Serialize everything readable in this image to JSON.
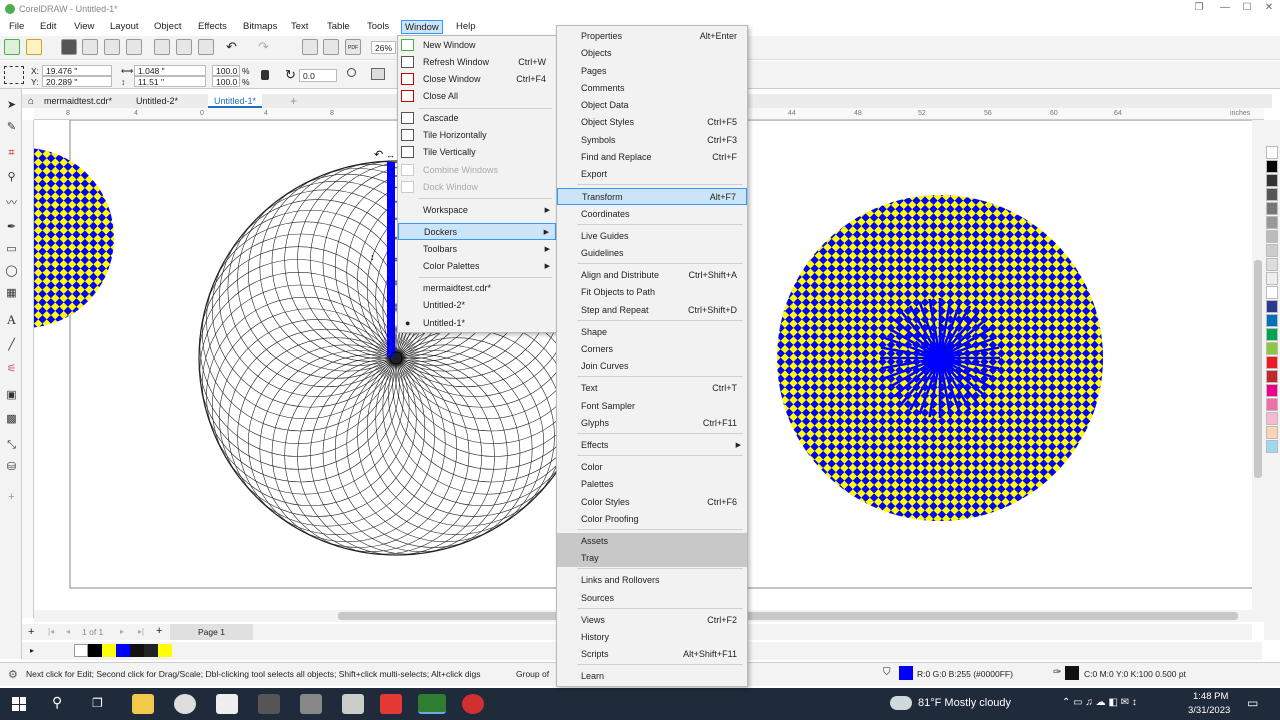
{
  "window": {
    "title": "CorelDRAW - Untitled-1*"
  },
  "menubar": [
    "File",
    "Edit",
    "View",
    "Layout",
    "Object",
    "Effects",
    "Bitmaps",
    "Text",
    "Table",
    "Tools",
    "Window",
    "Help"
  ],
  "toolbar": {
    "zoom": "26%"
  },
  "props": {
    "x": "19.476 \"",
    "y": "20.289 \"",
    "w": "1.048 \"",
    "h": "11.51 \"",
    "sx": "100.0",
    "sy": "100.0",
    "pct": "%",
    "rot": "0.0"
  },
  "tabs": [
    "mermaidtest.cdr*",
    "Untitled-2*",
    "Untitled-1*"
  ],
  "ruler_top": [
    "8",
    "4",
    "0",
    "4",
    "8",
    "12",
    "16",
    "40",
    "44",
    "48",
    "52",
    "56",
    "60",
    "64"
  ],
  "ruler_units": "inches",
  "window_menu": {
    "items": [
      {
        "label": "New Window",
        "shortcut": ""
      },
      {
        "label": "Refresh Window",
        "shortcut": "Ctrl+W"
      },
      {
        "label": "Close Window",
        "shortcut": "Ctrl+F4"
      },
      {
        "label": "Close All",
        "shortcut": ""
      },
      {
        "label": "Cascade",
        "shortcut": ""
      },
      {
        "label": "Tile Horizontally",
        "shortcut": ""
      },
      {
        "label": "Tile Vertically",
        "shortcut": ""
      },
      {
        "label": "Combine Windows",
        "shortcut": ""
      },
      {
        "label": "Dock Window",
        "shortcut": ""
      },
      {
        "label": "Workspace",
        "shortcut": ""
      },
      {
        "label": "Dockers",
        "shortcut": ""
      },
      {
        "label": "Toolbars",
        "shortcut": ""
      },
      {
        "label": "Color Palettes",
        "shortcut": ""
      },
      {
        "label": "mermaidtest.cdr*",
        "shortcut": ""
      },
      {
        "label": "Untitled-2*",
        "shortcut": ""
      },
      {
        "label": "Untitled-1*",
        "shortcut": ""
      }
    ]
  },
  "dockers_menu": {
    "items": [
      {
        "label": "Properties",
        "shortcut": "Alt+Enter"
      },
      {
        "label": "Objects",
        "shortcut": ""
      },
      {
        "label": "Pages",
        "shortcut": ""
      },
      {
        "label": "Comments",
        "shortcut": ""
      },
      {
        "label": "Object Data",
        "shortcut": ""
      },
      {
        "label": "Object Styles",
        "shortcut": "Ctrl+F5"
      },
      {
        "label": "Symbols",
        "shortcut": "Ctrl+F3"
      },
      {
        "label": "Find and Replace",
        "shortcut": "Ctrl+F"
      },
      {
        "label": "Export",
        "shortcut": ""
      },
      {
        "label": "Transform",
        "shortcut": "Alt+F7"
      },
      {
        "label": "Coordinates",
        "shortcut": ""
      },
      {
        "label": "Live Guides",
        "shortcut": ""
      },
      {
        "label": "Guidelines",
        "shortcut": ""
      },
      {
        "label": "Align and Distribute",
        "shortcut": "Ctrl+Shift+A"
      },
      {
        "label": "Fit Objects to Path",
        "shortcut": ""
      },
      {
        "label": "Step and Repeat",
        "shortcut": "Ctrl+Shift+D"
      },
      {
        "label": "Shape",
        "shortcut": ""
      },
      {
        "label": "Corners",
        "shortcut": ""
      },
      {
        "label": "Join Curves",
        "shortcut": ""
      },
      {
        "label": "Text",
        "shortcut": "Ctrl+T"
      },
      {
        "label": "Font Sampler",
        "shortcut": ""
      },
      {
        "label": "Glyphs",
        "shortcut": "Ctrl+F11"
      },
      {
        "label": "Effects",
        "shortcut": ""
      },
      {
        "label": "Color",
        "shortcut": ""
      },
      {
        "label": "Palettes",
        "shortcut": ""
      },
      {
        "label": "Color Styles",
        "shortcut": "Ctrl+F6"
      },
      {
        "label": "Color Proofing",
        "shortcut": ""
      },
      {
        "label": "Assets",
        "shortcut": ""
      },
      {
        "label": "Tray",
        "shortcut": ""
      },
      {
        "label": "Links and Rollovers",
        "shortcut": ""
      },
      {
        "label": "Sources",
        "shortcut": ""
      },
      {
        "label": "Views",
        "shortcut": "Ctrl+F2"
      },
      {
        "label": "History",
        "shortcut": ""
      },
      {
        "label": "Scripts",
        "shortcut": "Alt+Shift+F11"
      },
      {
        "label": "Learn",
        "shortcut": ""
      }
    ]
  },
  "pagenav": {
    "counter": "1 of 1",
    "page": "Page 1"
  },
  "status": {
    "hint": "Next click for Edit; Second click for Drag/Scale; Dbl-clicking tool selects all objects; Shift+click multi-selects; Alt+click digs",
    "object": "Group of",
    "fill": "R:0 G:0 B:255 (#0000FF)",
    "outline": "C:0 M:0 Y:0 K:100  0.500 pt"
  },
  "taskbar": {
    "weather": "81°F  Mostly cloudy",
    "time": "1:48 PM",
    "date": "3/31/2023"
  },
  "colors": {
    "blue": "#0000FF",
    "yellow": "#FFFF00",
    "accent": "#3399ff"
  }
}
